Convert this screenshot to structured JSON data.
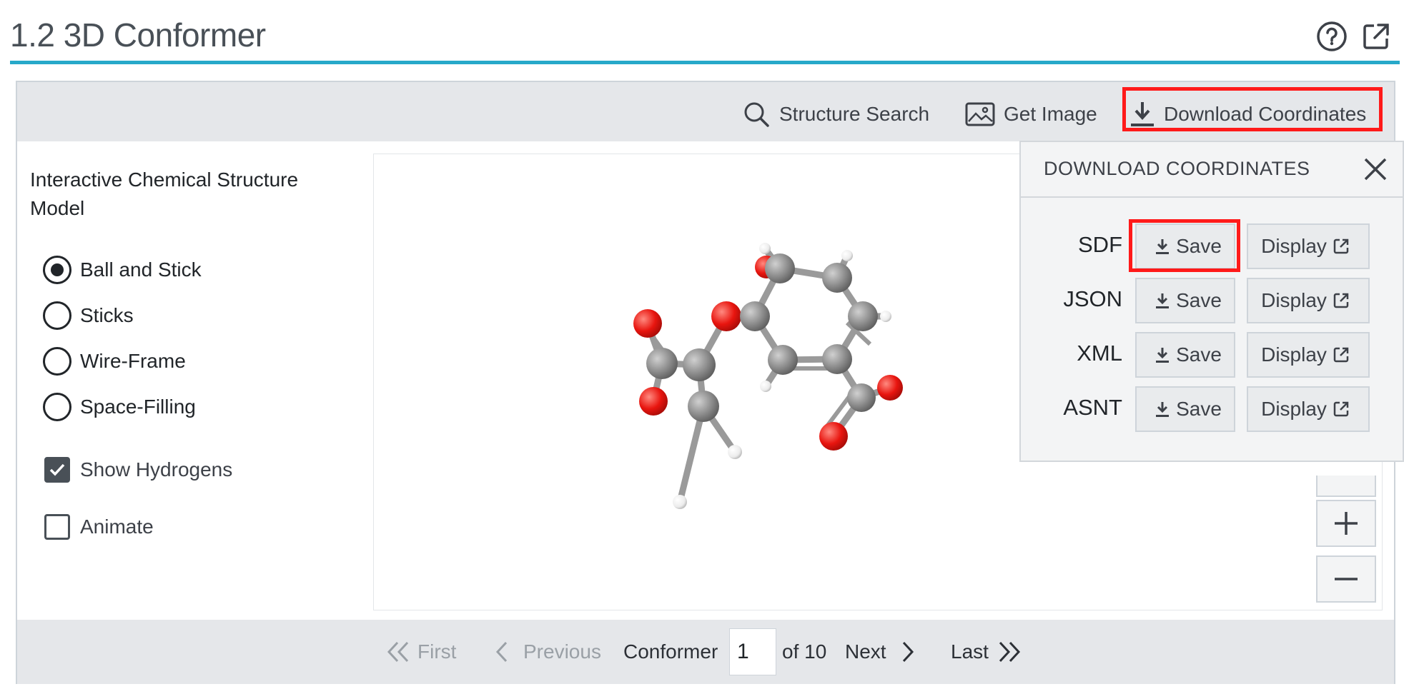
{
  "section": {
    "title": "1.2 3D Conformer"
  },
  "icons": {
    "help": "help-circle-icon",
    "external": "external-link-icon"
  },
  "toolbar": {
    "structure_search": "Structure Search",
    "get_image": "Get Image",
    "download_coordinates": "Download Coordinates"
  },
  "panel": {
    "title": "Interactive Chemical Structure Model",
    "render_options": [
      {
        "label": "Ball and Stick",
        "selected": true
      },
      {
        "label": "Sticks",
        "selected": false
      },
      {
        "label": "Wire-Frame",
        "selected": false
      },
      {
        "label": "Space-Filling",
        "selected": false
      }
    ],
    "show_hydrogens": {
      "label": "Show Hydrogens",
      "checked": true
    },
    "animate": {
      "label": "Animate",
      "checked": false
    }
  },
  "popup": {
    "title": "DOWNLOAD COORDINATES",
    "formats": [
      {
        "label": "SDF",
        "save": "Save",
        "display": "Display"
      },
      {
        "label": "JSON",
        "save": "Save",
        "display": "Display"
      },
      {
        "label": "XML",
        "save": "Save",
        "display": "Display"
      },
      {
        "label": "ASNT",
        "save": "Save",
        "display": "Display"
      }
    ]
  },
  "pager": {
    "first": "First",
    "previous": "Previous",
    "conformer_label": "Conformer",
    "current": "1",
    "of_total": "of 10",
    "next": "Next",
    "last": "Last"
  },
  "colors": {
    "accent_rule": "#27a9c9",
    "highlight": "#ff1a1a",
    "carbon": "#8c8c8c",
    "oxygen": "#e8150f",
    "hydrogen": "#f2f2f2"
  }
}
